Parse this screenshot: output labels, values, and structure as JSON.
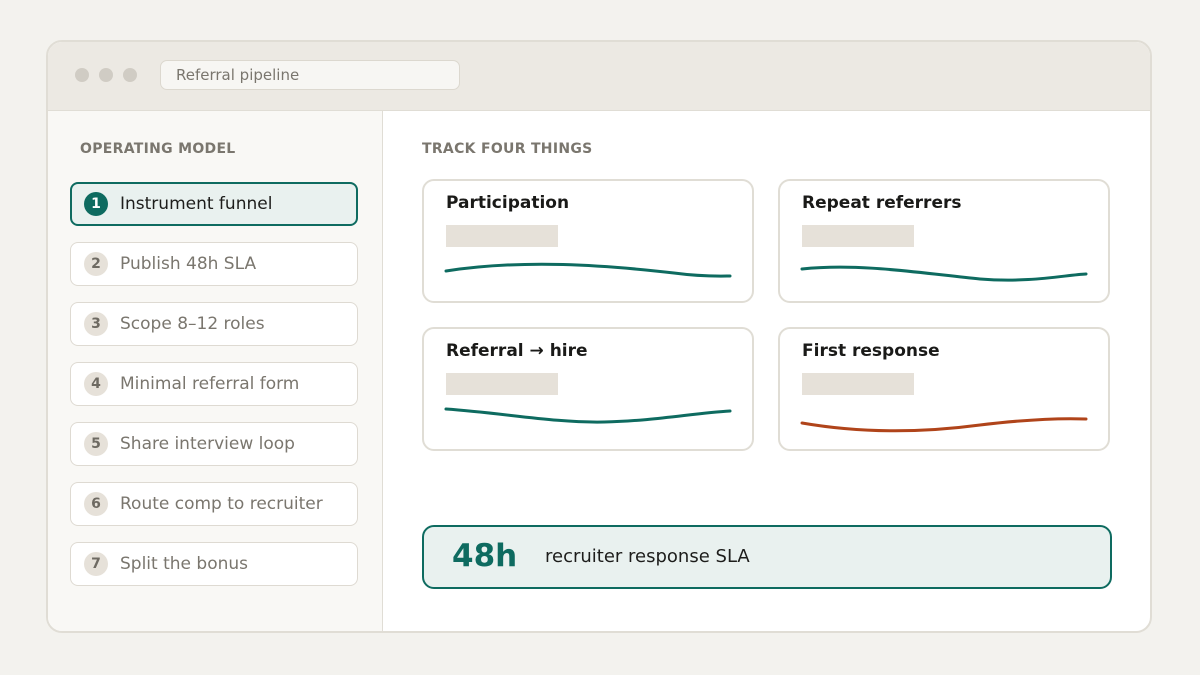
{
  "window": {
    "address_text": "Referral pipeline"
  },
  "sidebar": {
    "heading": "OPERATING MODEL",
    "steps": [
      {
        "number": "1",
        "label": "Instrument funnel",
        "active": true
      },
      {
        "number": "2",
        "label": "Publish 48h SLA",
        "active": false
      },
      {
        "number": "3",
        "label": "Scope 8–12 roles",
        "active": false
      },
      {
        "number": "4",
        "label": "Minimal referral form",
        "active": false
      },
      {
        "number": "5",
        "label": "Share interview loop",
        "active": false
      },
      {
        "number": "6",
        "label": "Route comp to recruiter",
        "active": false
      },
      {
        "number": "7",
        "label": "Split the bonus",
        "active": false
      }
    ]
  },
  "main": {
    "heading": "TRACK FOUR THINGS",
    "metrics": [
      {
        "title": "Participation",
        "trend_color": "#0e6b60"
      },
      {
        "title": "Repeat referrers",
        "trend_color": "#0e6b60"
      },
      {
        "title": "Referral → hire",
        "trend_color": "#0e6b60"
      },
      {
        "title": "First response",
        "trend_color": "#b0441a"
      }
    ],
    "sla": {
      "value": "48h",
      "label": "recruiter response SLA"
    }
  },
  "colors": {
    "accent": "#0e6b60",
    "warning": "#b0441a"
  }
}
